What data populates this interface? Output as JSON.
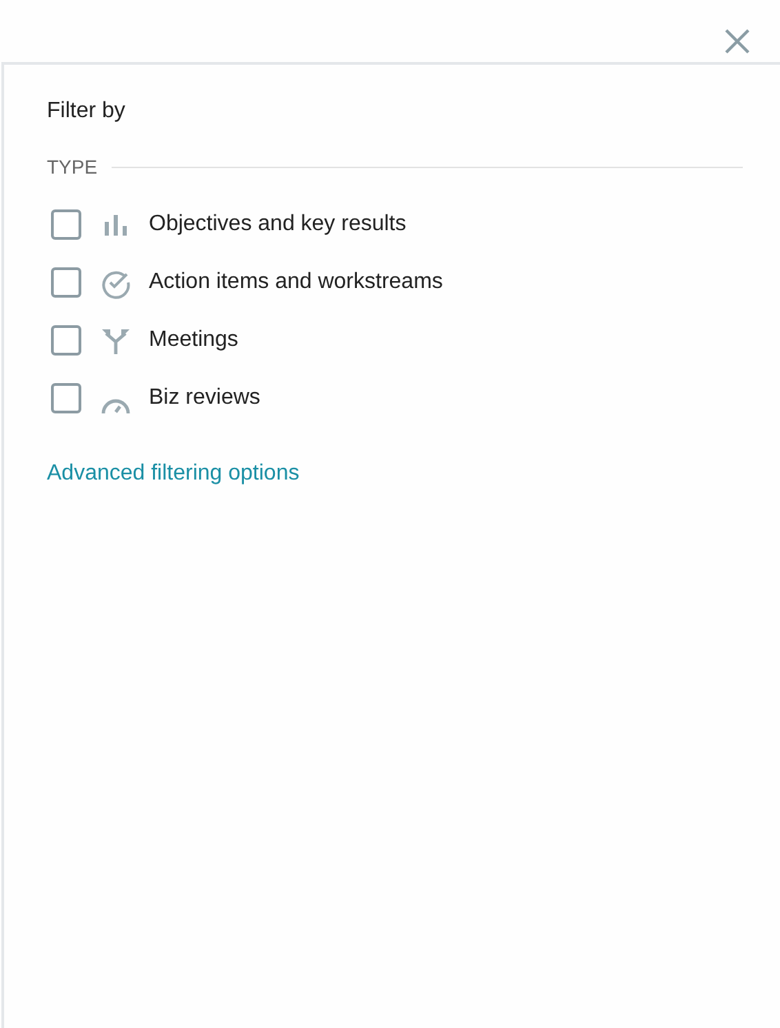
{
  "panel": {
    "title": "Filter by",
    "section": "TYPE",
    "types": [
      {
        "label": "Objectives and key results",
        "checked": false
      },
      {
        "label": "Action items and workstreams",
        "checked": false
      },
      {
        "label": "Meetings",
        "checked": false
      },
      {
        "label": "Biz reviews",
        "checked": false
      }
    ],
    "link": "Advanced filtering options"
  }
}
